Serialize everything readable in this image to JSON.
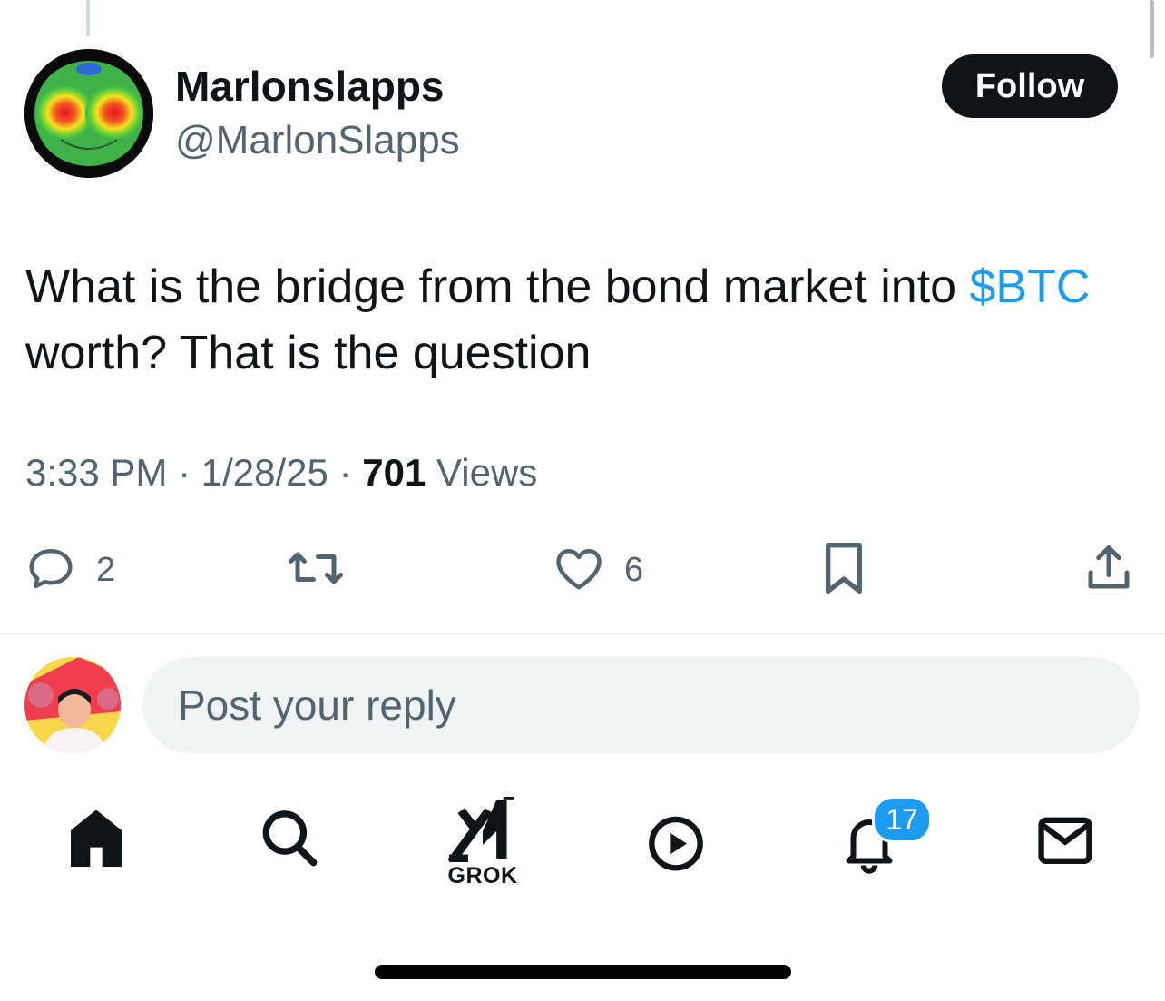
{
  "tweet": {
    "author_name": "Marlonslapps",
    "author_handle": "@MarlonSlapps",
    "follow_label": "Follow",
    "text_before": "What is the bridge from the bond market into ",
    "cashtag": "$BTC",
    "text_after": " worth? That is the question",
    "time": "3:33 PM",
    "separator": "·",
    "date": "1/28/25",
    "views_count": "701",
    "views_label": "Views"
  },
  "actions": {
    "reply_count": "2",
    "retweet_count": "",
    "like_count": "6"
  },
  "reply": {
    "placeholder": "Post your reply"
  },
  "nav": {
    "grok_label": "GROK",
    "notifications_badge": "17"
  },
  "colors": {
    "accent": "#1d9bf0",
    "text": "#0f1419",
    "secondary": "#536471",
    "reply_bg": "#eff3f4"
  },
  "icons": [
    "comment-icon",
    "retweet-icon",
    "heart-icon",
    "bookmark-icon",
    "share-icon",
    "home-icon",
    "search-icon",
    "grok-icon",
    "video-play-icon",
    "bell-icon",
    "mail-icon"
  ]
}
